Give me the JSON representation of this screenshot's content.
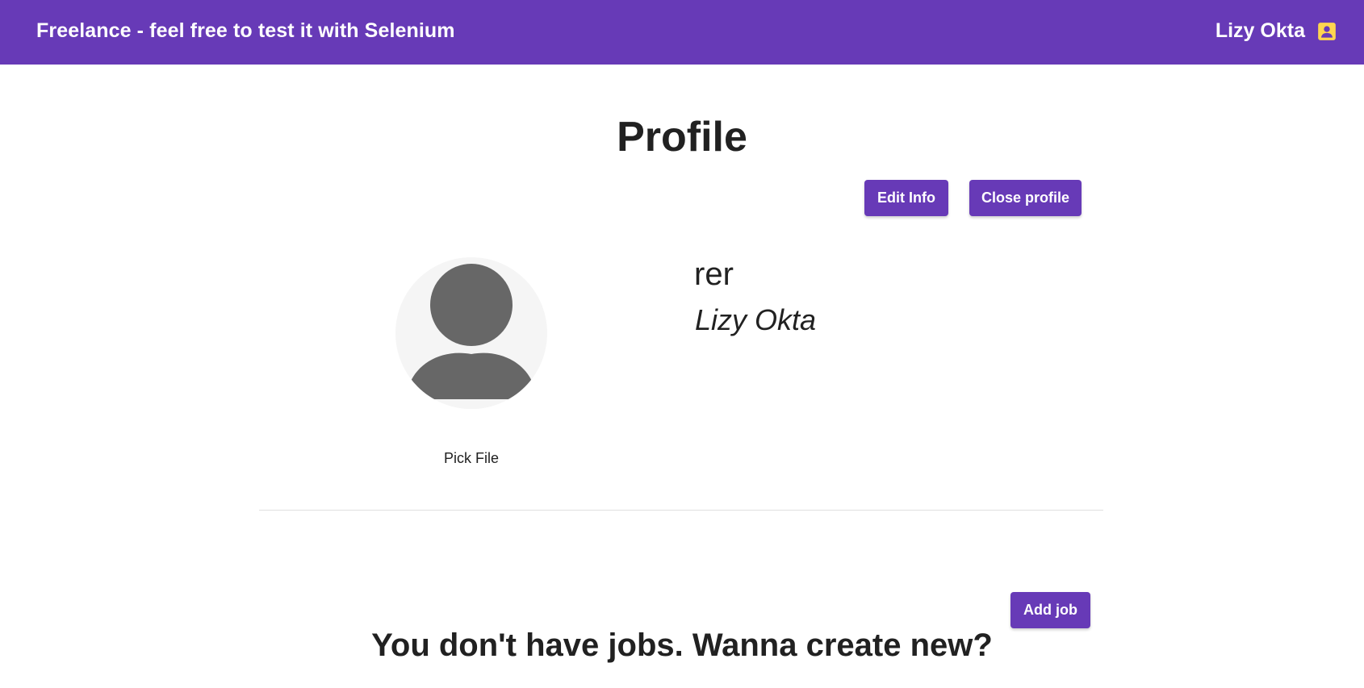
{
  "header": {
    "brand": "Freelance - feel free to test it with Selenium",
    "user_name": "Lizy Okta",
    "user_icon": "account-box-icon",
    "background_color": "#673ab7",
    "icon_color": "#ffd54f"
  },
  "profile": {
    "title": "Profile",
    "edit_button": "Edit Info",
    "close_button": "Close profile",
    "avatar_icon": "default-avatar-icon",
    "pick_file_label": "Pick File",
    "username": "rer",
    "full_name": "Lizy Okta"
  },
  "jobs": {
    "add_button": "Add job",
    "empty_message": "You don't have jobs. Wanna create new?"
  }
}
